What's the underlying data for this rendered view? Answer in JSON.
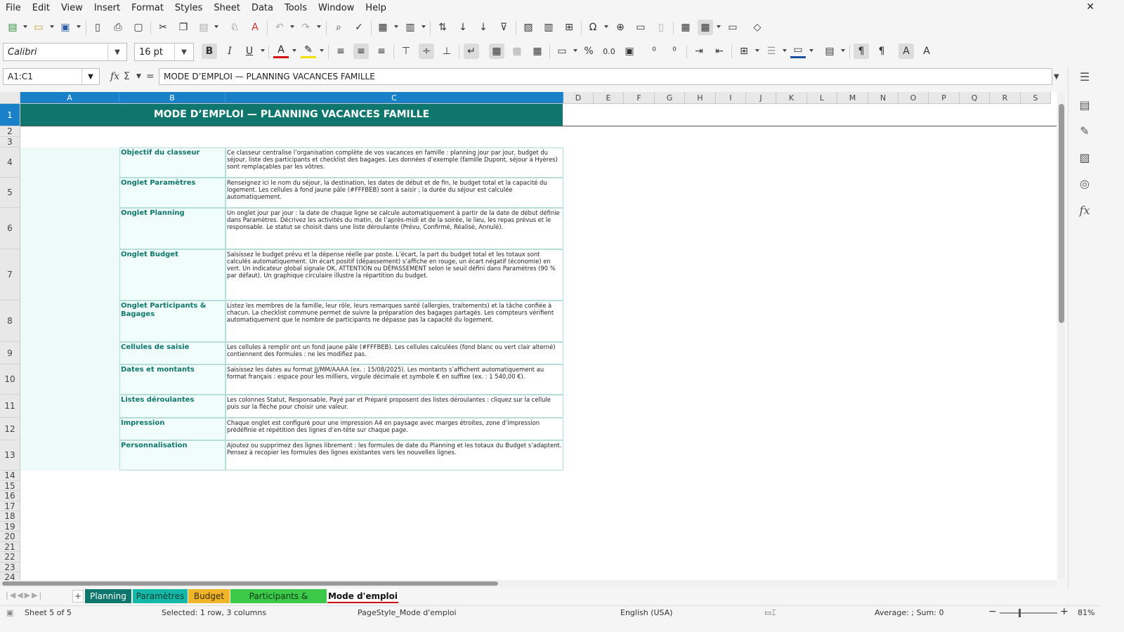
{
  "menu": [
    "File",
    "Edit",
    "View",
    "Insert",
    "Format",
    "Styles",
    "Sheet",
    "Data",
    "Tools",
    "Window",
    "Help"
  ],
  "window": {
    "close_glyph": "✕"
  },
  "toolbar": {
    "font_name": "Calibri",
    "font_size": "16 pt",
    "bold": "B",
    "italic": "I",
    "underline": "U",
    "percent": "%",
    "decimal": "0.0"
  },
  "formula_bar": {
    "cell_ref": "A1:C1",
    "content": "MODE D’EMPLOI — PLANNING VACANCES FAMILLE"
  },
  "columns": [
    "A",
    "B",
    "C",
    "D",
    "E",
    "F",
    "G",
    "H",
    "I",
    "J",
    "K",
    "L",
    "M",
    "N",
    "O",
    "P",
    "Q",
    "R",
    "S"
  ],
  "rows": [
    "1",
    "2",
    "3",
    "4",
    "5",
    "6",
    "7",
    "8",
    "9",
    "10",
    "11",
    "12",
    "13",
    "14",
    "15",
    "16",
    "17",
    "18",
    "19",
    "20",
    "21",
    "22",
    "23",
    "24"
  ],
  "sheet": {
    "title": "MODE D’EMPLOI — PLANNING VACANCES FAMILLE",
    "entries": [
      {
        "label": "Objectif du classeur",
        "text": "Ce classeur centralise l’organisation complète de vos vacances en famille : planning jour par jour, budget du séjour, liste des participants et checklist des bagages. Les données d’exemple (famille Dupont, séjour à Hyères) sont remplaçables par les vôtres."
      },
      {
        "label": "Onglet Paramètres",
        "text": "Renseignez ici le nom du séjour, la destination, les dates de début et de fin, le budget total et la capacité du logement. Les cellules à fond jaune pâle (#FFFBEB) sont à saisir ; la durée du séjour est calculée automatiquement."
      },
      {
        "label": "Onglet Planning",
        "text": "Un onglet jour par jour : la date de chaque ligne se calcule automatiquement à partir de la date de début définie dans Paramètres. Décrivez les activités du matin, de l’après-midi et de la soirée, le lieu, les repas prévus et le responsable. Le statut se choisit dans une liste déroulante (Prévu, Confirmé, Réalisé, Annulé)."
      },
      {
        "label": "Onglet Budget",
        "text": "Saisissez le budget prévu et la dépense réelle par poste. L’écart, la part du budget total et les totaux sont calculés automatiquement. Un écart positif (dépassement) s’affiche en rouge, un écart négatif (économie) en vert. Un indicateur global signale OK, ATTENTION ou DÉPASSEMENT selon le seuil défini dans Paramètres (90 % par défaut). Un graphique circulaire illustre la répartition du budget."
      },
      {
        "label": "Onglet Participants & Bagages",
        "text": "Listez les membres de la famille, leur rôle, leurs remarques santé (allergies, traitements) et la tâche confiée à chacun. La checklist commune permet de suivre la préparation des bagages partagés. Les compteurs vérifient automatiquement que le nombre de participants ne dépasse pas la capacité du logement."
      },
      {
        "label": "Cellules de saisie",
        "text": "Les cellules à remplir ont un fond jaune pâle (#FFFBEB). Les cellules calculées (fond blanc ou vert clair alterné) contiennent des formules : ne les modifiez pas."
      },
      {
        "label": "Dates et montants",
        "text": "Saisissez les dates au format JJ/MM/AAAA (ex. : 15/08/2025). Les montants s’affichent automatiquement au format français : espace pour les milliers, virgule décimale et symbole € en suffixe (ex. : 1 540,00 €)."
      },
      {
        "label": "Listes déroulantes",
        "text": "Les colonnes Statut, Responsable, Payé par et Préparé proposent des listes déroulantes : cliquez sur la cellule puis sur la flèche pour choisir une valeur."
      },
      {
        "label": "Impression",
        "text": "Chaque onglet est configuré pour une impression A4 en paysage avec marges étroites, zone d’impression prédéfinie et répétition des lignes d’en-tête sur chaque page."
      },
      {
        "label": "Personnalisation",
        "text": "Ajoutez ou supprimez des lignes librement : les formules de date du Planning et les totaux du Budget s’adaptent. Pensez à recopier les formules des lignes existantes vers les nouvelles lignes."
      }
    ]
  },
  "tabs": [
    {
      "label": "Planning",
      "color": "#0f766e",
      "text_color": "#ffffff"
    },
    {
      "label": "Paramètres",
      "color": "#14b8a6",
      "text_color": "#0b3b36"
    },
    {
      "label": "Budget",
      "color": "#f0b429",
      "text_color": "#3b2a00"
    },
    {
      "label": "Participants & Bagages",
      "color": "#3cc94a",
      "text_color": "#0b3b12"
    },
    {
      "label": "Mode d'emploi",
      "color": "#ffffff",
      "text_color": "#111111"
    }
  ],
  "status": {
    "sheet": "Sheet 5 of 5",
    "selection": "Selected: 1 row, 3 columns",
    "page_style": "PageStyle_Mode d'emploi",
    "language": "English (USA)",
    "summary": "Average: ; Sum: 0",
    "zoom": "81%"
  },
  "colors": {
    "accent": "#0f766e",
    "selection": "#1a80c8",
    "label_bg": "#f0fdfa"
  }
}
